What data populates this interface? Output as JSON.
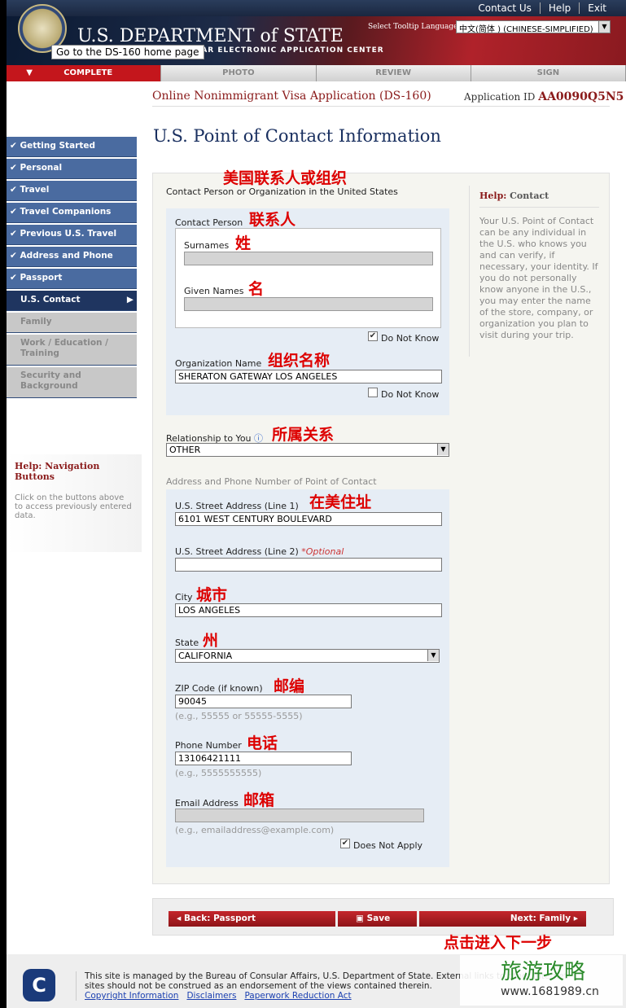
{
  "header": {
    "links": [
      "Contact Us",
      "Help",
      "Exit"
    ],
    "title": "U.S. DEPARTMENT of STATE",
    "subtitle": "CONSULAR ELECTRONIC APPLICATION CENTER",
    "tooltip": "Go to the DS-160 home page",
    "tooltip_language_label": "Select Tooltip Language",
    "tooltip_language_value": "中文(简体 ) (CHINESE-SIMPLIFIED)"
  },
  "steps": [
    "COMPLETE",
    "PHOTO",
    "REVIEW",
    "SIGN"
  ],
  "app": {
    "title": "Online Nonimmigrant Visa Application (DS-160)",
    "id_label": "Application ID",
    "id": "AA0090Q5N5"
  },
  "page_title": "U.S. Point of Contact Information",
  "nav": [
    {
      "label": "Getting Started",
      "state": "done"
    },
    {
      "label": "Personal",
      "state": "done"
    },
    {
      "label": "Travel",
      "state": "done"
    },
    {
      "label": "Travel Companions",
      "state": "done"
    },
    {
      "label": "Previous U.S. Travel",
      "state": "done"
    },
    {
      "label": "Address and Phone",
      "state": "done"
    },
    {
      "label": "Passport",
      "state": "done"
    },
    {
      "label": "U.S. Contact",
      "state": "current"
    },
    {
      "label": "Family",
      "state": "disabled"
    },
    {
      "label": "Work / Education / Training",
      "state": "disabled"
    },
    {
      "label": "Security and Background",
      "state": "disabled"
    }
  ],
  "nav_help": {
    "title": "Help: Navigation Buttons",
    "text": "Click on the buttons above to access previously entered data."
  },
  "form": {
    "section1": "Contact Person or Organization in the United States",
    "contact_person": "Contact Person",
    "surnames_label": "Surnames",
    "surnames": "",
    "given_label": "Given Names",
    "given": "",
    "do_not_know": "Do Not Know",
    "org_label": "Organization Name",
    "org": "SHERATON GATEWAY LOS ANGELES",
    "relationship_label": "Relationship to You",
    "relationship": "OTHER",
    "section2": "Address and Phone Number of Point of Contact",
    "street1_label": "U.S. Street Address (Line 1)",
    "street1": "6101 WEST CENTURY BOULEVARD",
    "street2_label": "U.S. Street Address (Line 2)",
    "optional": "*Optional",
    "street2": "",
    "city_label": "City",
    "city": "LOS ANGELES",
    "state_label": "State",
    "state": "CALIFORNIA",
    "zip_label": "ZIP Code (if known)",
    "zip": "90045",
    "zip_hint": "(e.g., 55555 or 55555-5555)",
    "phone_label": "Phone Number",
    "phone": "13106421111",
    "phone_hint": "(e.g., 5555555555)",
    "email_label": "Email Address",
    "email": "",
    "email_hint": "(e.g., emailaddress@example.com)",
    "does_not_apply": "Does Not Apply"
  },
  "help": {
    "title": "Help:",
    "topic": "Contact",
    "text": "Your U.S. Point of Contact can be any individual in the U.S. who knows you and can verify, if necessary, your identity. If you do not personally know anyone in the U.S., you may enter the name of the store, company, or organization you plan to visit during your trip."
  },
  "annotations": {
    "section1": "美国联系人或组织",
    "contact_person": "联系人",
    "surnames": "姓",
    "given": "名",
    "org": "组织名称",
    "relationship": "所属关系",
    "street": "在美住址",
    "city": "城市",
    "state": "州",
    "zip": "邮编",
    "phone": "电话",
    "email": "邮箱",
    "next": "点击进入下一步"
  },
  "buttons": {
    "back": "Back: Passport",
    "save": "Save",
    "next": "Next: Family"
  },
  "footer": {
    "text1": "This site is managed by the Bureau of Consular Affairs, U.S. Department of State. External links to other Internet",
    "text2": "sites should not be construed as an endorsement of the views contained therein.",
    "links": [
      "Copyright Information",
      "Disclaimers",
      "Paperwork Reduction Act"
    ]
  },
  "watermark": {
    "text": "旅游攻略",
    "url": "www.1681989.cn"
  },
  "colors": {
    "accent": "#c4161c",
    "nav": "#4a6ba0",
    "title": "#1a3060"
  }
}
